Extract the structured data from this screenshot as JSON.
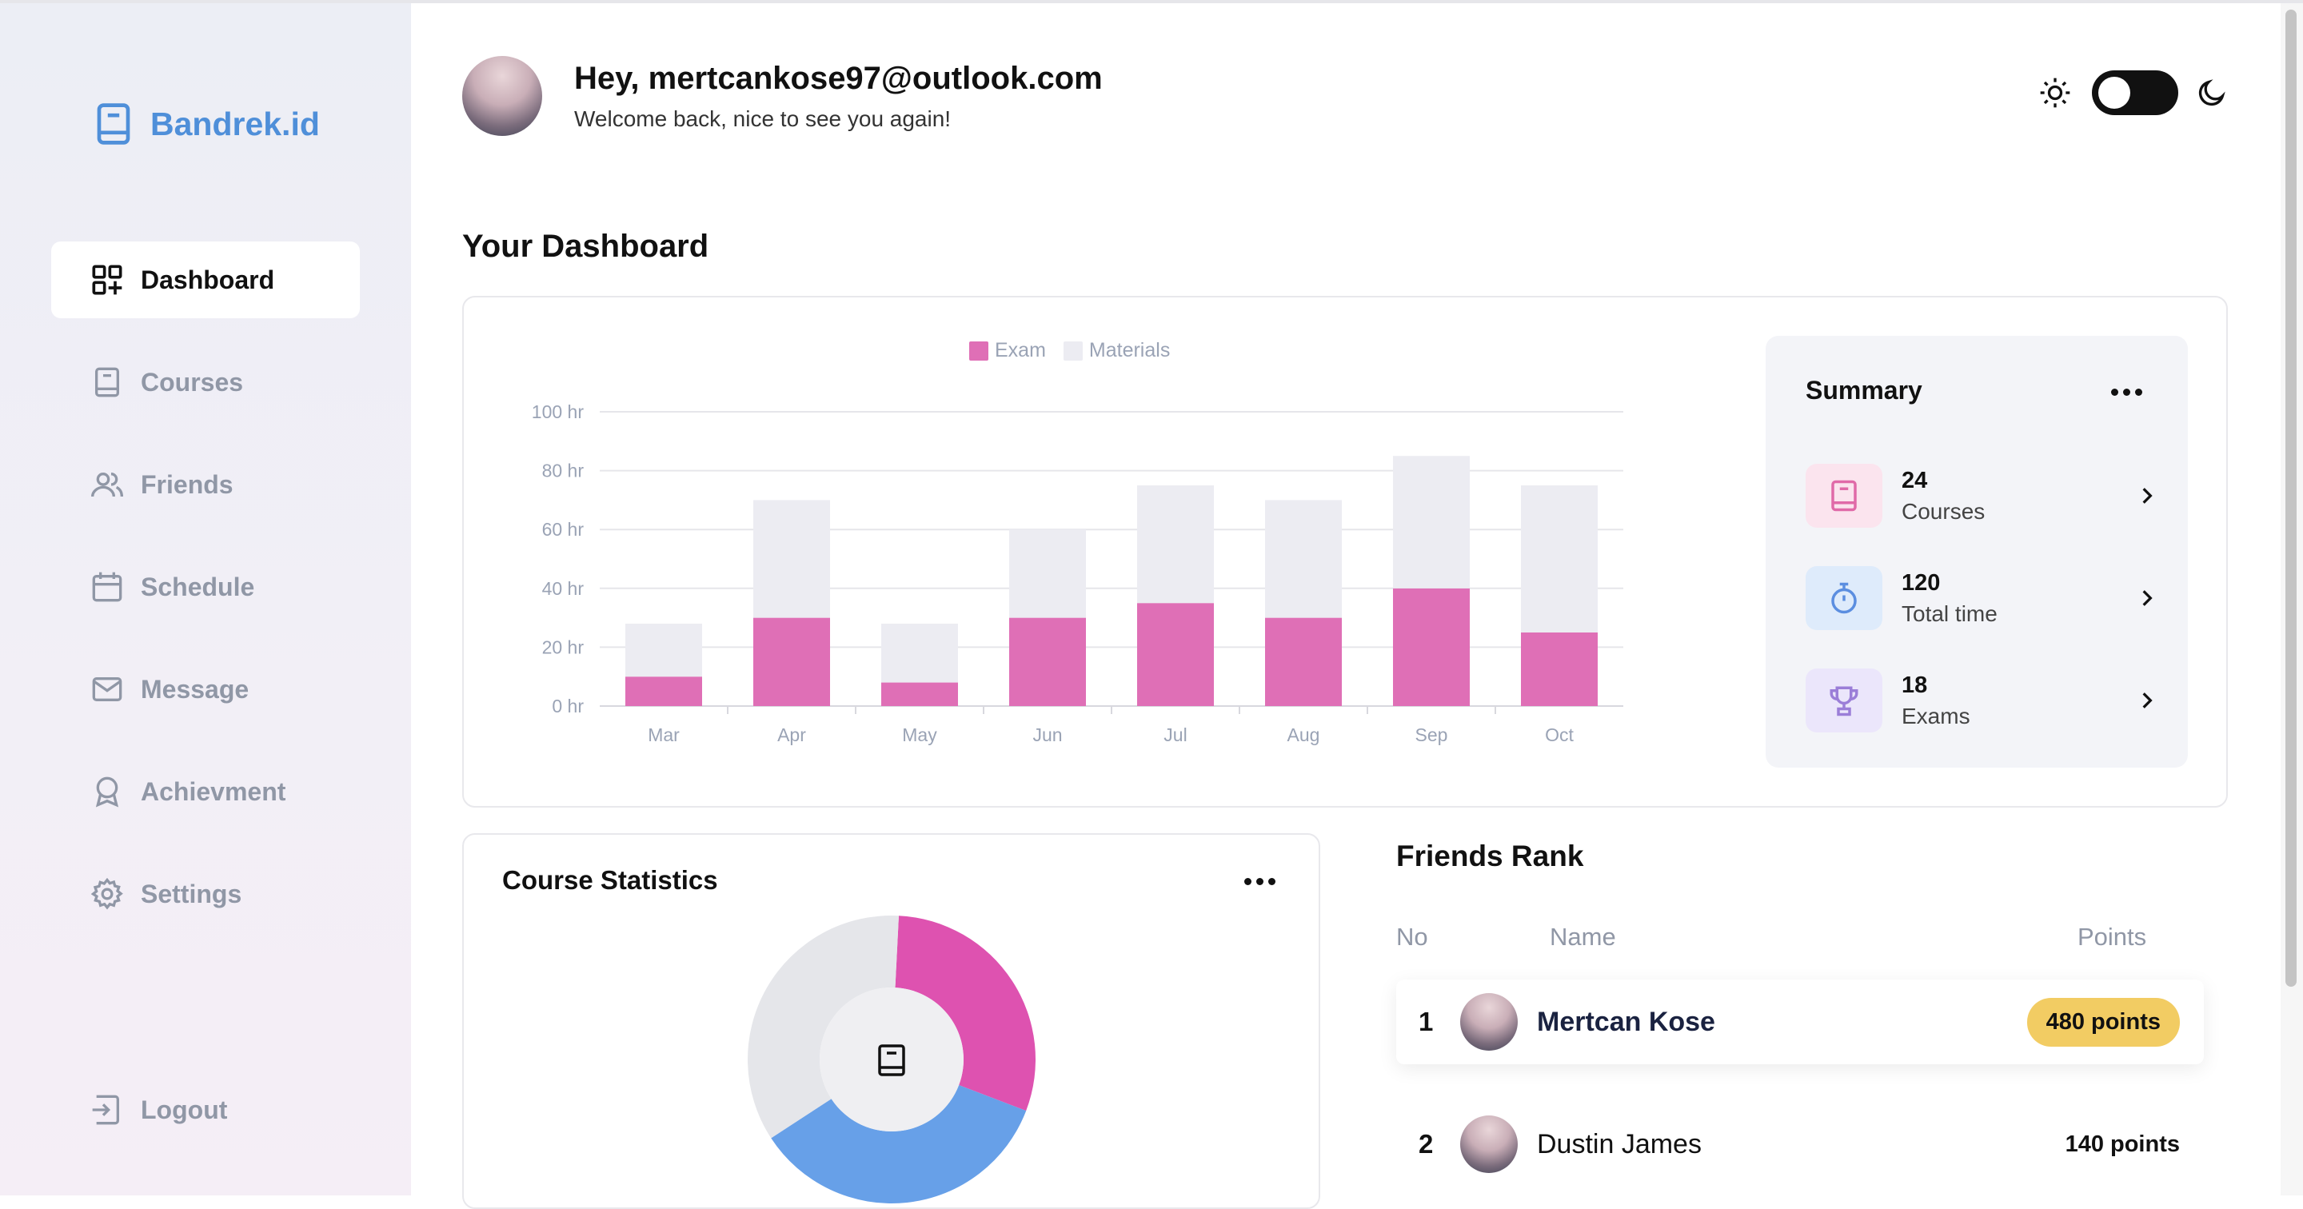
{
  "brand": {
    "name": "Bandrek.id"
  },
  "sidebar": {
    "items": [
      {
        "label": "Dashboard",
        "icon": "dashboard-icon",
        "active": true
      },
      {
        "label": "Courses",
        "icon": "book-icon"
      },
      {
        "label": "Friends",
        "icon": "users-icon"
      },
      {
        "label": "Schedule",
        "icon": "calendar-icon"
      },
      {
        "label": "Message",
        "icon": "mail-icon"
      },
      {
        "label": "Achievment",
        "icon": "award-icon"
      },
      {
        "label": "Settings",
        "icon": "gear-icon"
      }
    ],
    "logout": "Logout"
  },
  "header": {
    "greeting": "Hey, mertcankose97@outlook.com",
    "subtitle": "Welcome back, nice to see you again!",
    "theme_toggle": {
      "state": "light"
    }
  },
  "dashboard": {
    "title": "Your Dashboard"
  },
  "chart_data": {
    "type": "bar",
    "stacked": true,
    "categories": [
      "Mar",
      "Apr",
      "May",
      "Jun",
      "Jul",
      "Aug",
      "Sep",
      "Oct"
    ],
    "series": [
      {
        "name": "Exam",
        "color": "#df6fb6",
        "values": [
          10,
          30,
          8,
          30,
          35,
          30,
          40,
          25
        ]
      },
      {
        "name": "Materials",
        "color": "#ececf2",
        "values": [
          18,
          40,
          20,
          30,
          40,
          40,
          45,
          50
        ]
      }
    ],
    "y_ticks": [
      "0 hr",
      "20 hr",
      "40 hr",
      "60 hr",
      "80 hr",
      "100 hr"
    ],
    "ylim": [
      0,
      100
    ],
    "grid": true,
    "legend": "top"
  },
  "summary": {
    "title": "Summary",
    "items": [
      {
        "value": "24",
        "label": "Courses",
        "icon": "book-icon",
        "bg": "#fbe4ee",
        "fg": "#e06aa8"
      },
      {
        "value": "120",
        "label": "Total time",
        "icon": "stopwatch-icon",
        "bg": "#deebfb",
        "fg": "#5b8ee0"
      },
      {
        "value": "18",
        "label": "Exams",
        "icon": "trophy-icon",
        "bg": "#ebe6fb",
        "fg": "#9b7ed8"
      }
    ]
  },
  "course_stats": {
    "title": "Course Statistics",
    "chart_data": {
      "type": "pie",
      "slices": [
        {
          "value": 30,
          "color": "#de52b0"
        },
        {
          "value": 35,
          "color": "#67a0e8"
        },
        {
          "value": 35,
          "color": "#e5e6ea"
        }
      ]
    }
  },
  "friends_rank": {
    "title": "Friends Rank",
    "columns": [
      "No",
      "Name",
      "Points"
    ],
    "rows": [
      {
        "no": "1",
        "name": "Mertcan Kose",
        "points": "480 points"
      },
      {
        "no": "2",
        "name": "Dustin James",
        "points": "140 points"
      }
    ]
  }
}
